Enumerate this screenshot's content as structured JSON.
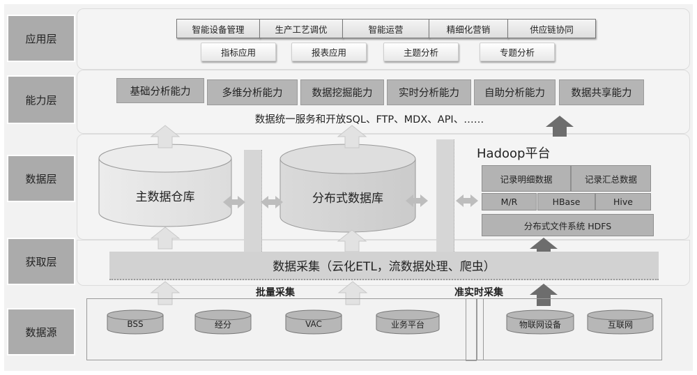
{
  "layers": [
    {
      "id": "app",
      "label": "应用层"
    },
    {
      "id": "capability",
      "label": "能力层"
    },
    {
      "id": "data",
      "label": "数据层"
    },
    {
      "id": "acquisition",
      "label": "获取层"
    },
    {
      "id": "source",
      "label": "数据源"
    }
  ],
  "application": {
    "row1": [
      "智能设备管理",
      "生产工艺调优",
      "智能运营",
      "精细化营销",
      "供应链协同"
    ],
    "row2": [
      "指标应用",
      "报表应用",
      "主题分析",
      "专题分析"
    ]
  },
  "capability": {
    "items": [
      "基础分析能力",
      "多维分析能力",
      "数据挖掘能力",
      "实时分析能力",
      "自助分析能力",
      "数据共享能力"
    ],
    "service_text": "数据统一服务和开放SQL、FTP、MDX、API、……"
  },
  "data_layer": {
    "main_warehouse": "主数据仓库",
    "distributed_db": "分布式数据库",
    "hadoop": {
      "title": "Hadoop平台",
      "row1": [
        "记录明细数据",
        "记录汇总数据"
      ],
      "row2": [
        "M/R",
        "HBase",
        "Hive"
      ],
      "hdfs": "分布式文件系统 HDFS"
    }
  },
  "acquisition": {
    "collect_text": "数据采集（云化ETL，流数据处理、爬虫）",
    "batch_label": "批量采集",
    "realtime_label": "准实时采集"
  },
  "sources": {
    "batch": [
      "BSS",
      "经分",
      "VAC",
      "业务平台"
    ],
    "realtime": [
      "物联网设备",
      "互联网"
    ]
  },
  "colors": {
    "label_bg": "#ababab",
    "capability_bg": "#b5b5b5",
    "arrow_light": "#e2e2e2",
    "arrow_dark": "#6d6d6d",
    "cylinder": "#e4e4e4",
    "source_cylinder": "#b7b7b7"
  }
}
